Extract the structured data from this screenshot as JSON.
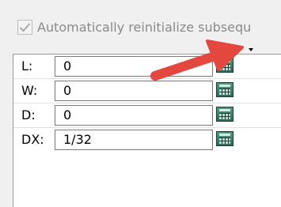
{
  "options": {
    "auto_reinit_label": "Automatically reinitialize subsequ",
    "auto_reinit_checked": true
  },
  "fields": [
    {
      "label": "L:",
      "value": "0"
    },
    {
      "label": "W:",
      "value": "0"
    },
    {
      "label": "D:",
      "value": "0"
    },
    {
      "label": "DX:",
      "value": "1/32"
    }
  ],
  "icons": {
    "checkmark": "check-icon",
    "dropdown": "dropdown-triangle-icon",
    "calculator": "calculator-icon",
    "annotation_arrow": "arrow-icon"
  },
  "colors": {
    "panel_bg": "#ffffff",
    "window_bg": "#f0f0f0",
    "arrow": "#e3473d",
    "calculator": "#3b7f69"
  }
}
